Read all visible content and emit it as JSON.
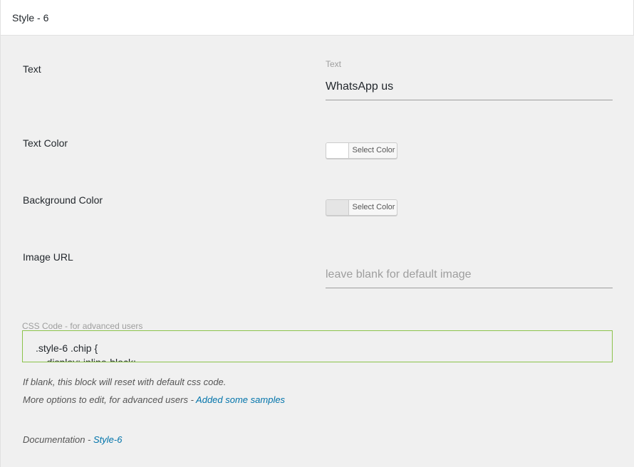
{
  "header": {
    "title": "Style - 6"
  },
  "fields": {
    "text": {
      "label": "Text",
      "caption": "Text",
      "value": "WhatsApp us"
    },
    "text_color": {
      "label": "Text Color",
      "button_label": "Select Color",
      "swatch": "#ffffff"
    },
    "background_color": {
      "label": "Background Color",
      "button_label": "Select Color",
      "swatch": "#e5e5e5"
    },
    "image_url": {
      "label": "Image URL",
      "placeholder": "leave blank for default image"
    }
  },
  "css_code": {
    "caption": "CSS Code - for advanced users",
    "line1": ".style-6 .chip {",
    "line2": "    display: inline-block;",
    "border_color": "#8bc34a"
  },
  "notes": {
    "reset": "If blank, this block will reset with default css code.",
    "more_options": "More options to edit, for advanced users - ",
    "samples_link": "Added some samples",
    "documentation": "Documentation - ",
    "doc_link": "Style-6"
  },
  "colors": {
    "link": "#0073aa",
    "accent": "#8bc34a"
  }
}
